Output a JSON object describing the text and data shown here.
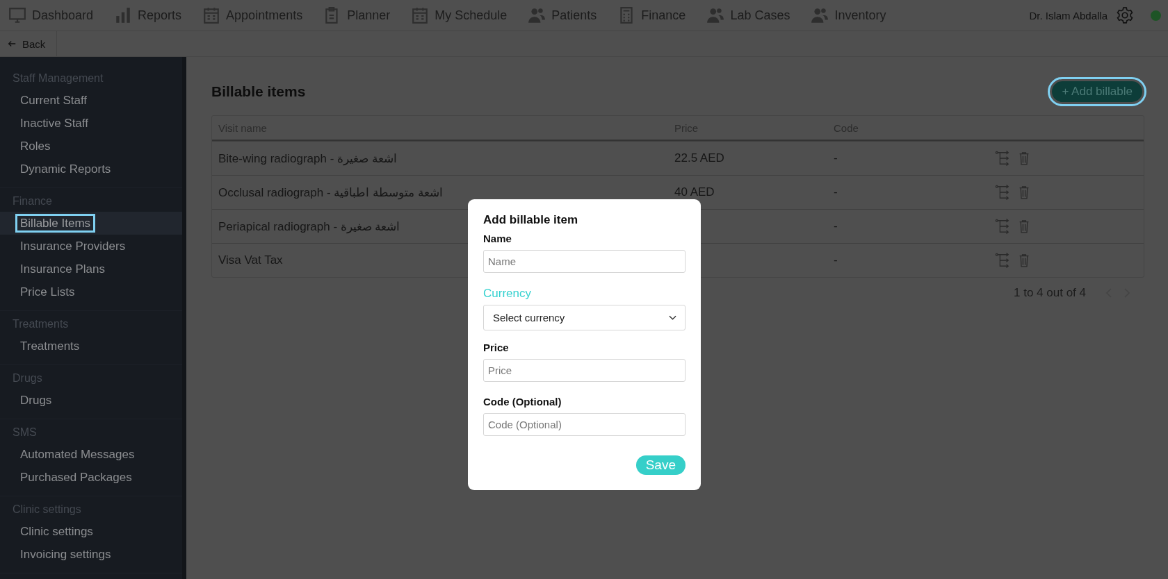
{
  "nav": {
    "items": [
      {
        "label": "Dashboard"
      },
      {
        "label": "Reports"
      },
      {
        "label": "Appointments"
      },
      {
        "label": "Planner"
      },
      {
        "label": "My Schedule"
      },
      {
        "label": "Patients"
      },
      {
        "label": "Finance"
      },
      {
        "label": "Lab Cases"
      },
      {
        "label": "Inventory"
      }
    ],
    "user": "Dr. Islam Abdalla"
  },
  "back": {
    "label": "Back"
  },
  "sidebar": {
    "groups": [
      {
        "heading": "Staff Management",
        "items": [
          {
            "label": "Current Staff",
            "selected": false
          },
          {
            "label": "Inactive Staff",
            "selected": false
          },
          {
            "label": "Roles",
            "selected": false
          },
          {
            "label": "Dynamic Reports",
            "selected": false
          }
        ]
      },
      {
        "heading": "Finance",
        "items": [
          {
            "label": "Billable Items",
            "selected": true
          },
          {
            "label": "Insurance Providers",
            "selected": false
          },
          {
            "label": "Insurance Plans",
            "selected": false
          },
          {
            "label": "Price Lists",
            "selected": false
          }
        ]
      },
      {
        "heading": "Treatments",
        "items": [
          {
            "label": "Treatments",
            "selected": false
          }
        ]
      },
      {
        "heading": "Drugs",
        "items": [
          {
            "label": "Drugs",
            "selected": false
          }
        ]
      },
      {
        "heading": "SMS",
        "items": [
          {
            "label": "Automated Messages",
            "selected": false
          },
          {
            "label": "Purchased Packages",
            "selected": false
          }
        ]
      },
      {
        "heading": "Clinic settings",
        "items": [
          {
            "label": "Clinic settings",
            "selected": false
          },
          {
            "label": "Invoicing settings",
            "selected": false
          }
        ]
      }
    ]
  },
  "page": {
    "title": "Billable items",
    "add_button": "+ Add billable"
  },
  "table": {
    "columns": [
      "Visit name",
      "Price",
      "Code"
    ],
    "rows": [
      {
        "name": "Bite-wing radiograph - اشعة صغيرة",
        "price": "22.5 AED",
        "code": "-"
      },
      {
        "name": "Occlusal radiograph - اشعة متوسطة اطباقية",
        "price": "40 AED",
        "code": "-"
      },
      {
        "name": "Periapical radiograph - اشعة صغيرة",
        "code": "-"
      },
      {
        "name": "Visa Vat Tax",
        "code": "-"
      }
    ]
  },
  "pagination": {
    "summary": "1 to 4 out of 4"
  },
  "modal": {
    "title": "Add billable item",
    "fields": [
      {
        "kind": "input",
        "label": "Name",
        "placeholder": "Name",
        "focused": false
      },
      {
        "kind": "select",
        "label": "Currency",
        "placeholder": "Select currency",
        "focused": true
      },
      {
        "kind": "input",
        "label": "Price",
        "placeholder": "Price",
        "focused": false
      },
      {
        "kind": "input",
        "label": "Code (Optional)",
        "placeholder": "Code (Optional)",
        "focused": false
      }
    ],
    "save": "Save"
  }
}
